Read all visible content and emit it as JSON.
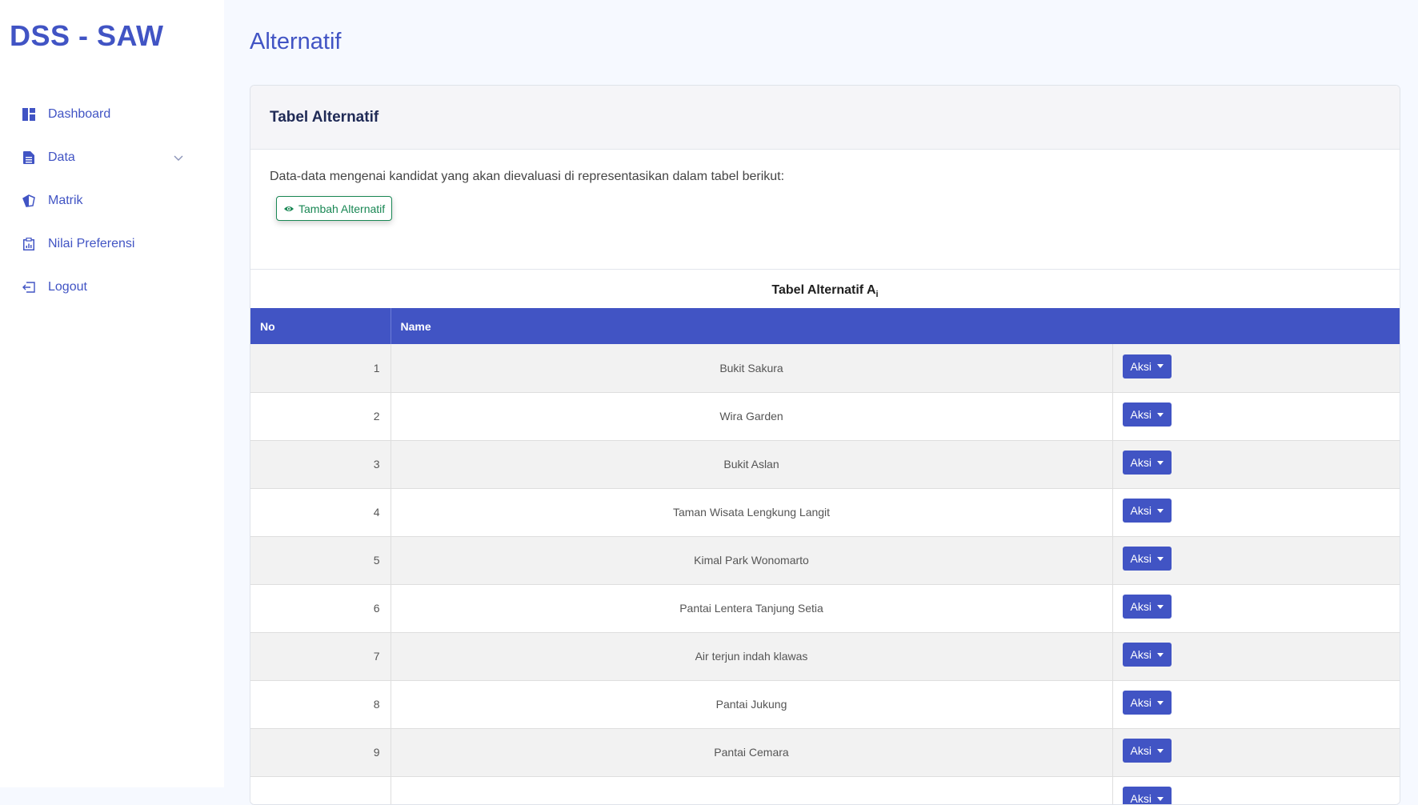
{
  "brand": "DSS - SAW",
  "sidebar": {
    "items": [
      {
        "label": "Dashboard",
        "icon": "grid-icon"
      },
      {
        "label": "Data",
        "icon": "document-icon",
        "expandable": true
      },
      {
        "label": "Matrik",
        "icon": "gem-icon"
      },
      {
        "label": "Nilai Preferensi",
        "icon": "report-icon"
      },
      {
        "label": "Logout",
        "icon": "logout-icon"
      }
    ]
  },
  "page": {
    "title": "Alternatif"
  },
  "card": {
    "header": "Tabel Alternatif",
    "description": "Data-data mengenai kandidat yang akan dievaluasi di representasikan dalam tabel berikut:",
    "add_button": "Tambah Alternatif"
  },
  "table": {
    "caption": "Tabel Alternatif A",
    "caption_sub": "i",
    "columns": [
      "No",
      "Name"
    ],
    "action_label": "Aksi",
    "rows": [
      {
        "no": "1",
        "name": "Bukit Sakura"
      },
      {
        "no": "2",
        "name": "Wira Garden"
      },
      {
        "no": "3",
        "name": "Bukit Aslan"
      },
      {
        "no": "4",
        "name": "Taman Wisata Lengkung Langit"
      },
      {
        "no": "5",
        "name": "Kimal Park Wonomarto"
      },
      {
        "no": "6",
        "name": "Pantai Lentera Tanjung Setia"
      },
      {
        "no": "7",
        "name": "Air terjun indah klawas"
      },
      {
        "no": "8",
        "name": "Pantai Jukung"
      },
      {
        "no": "9",
        "name": "Pantai Cemara"
      },
      {
        "no": "",
        "name": ""
      }
    ]
  },
  "colors": {
    "primary": "#4154c4",
    "success": "#198754",
    "background": "#f6f9ff"
  }
}
